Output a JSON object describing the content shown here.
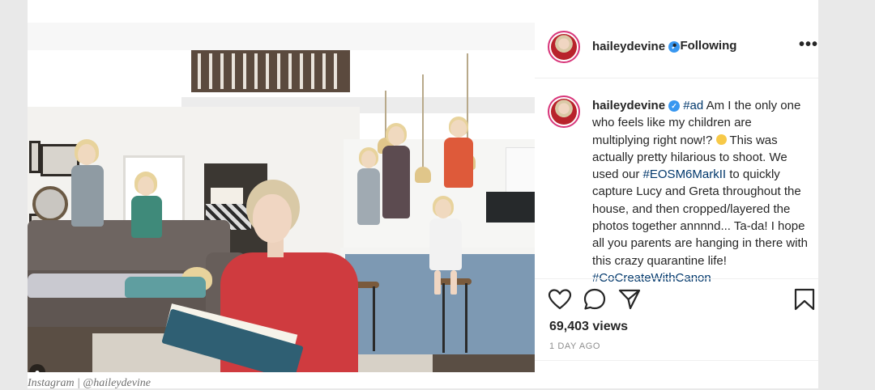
{
  "post": {
    "username": "haileydevine",
    "follow_status": "Following",
    "caption_parts": {
      "hashtag_ad": "#ad",
      "text1": " Am I the only one who feels like my children are multiplying right now!?",
      "text2": " This was actually pretty hilarious to shoot. We used our ",
      "hashtag_camera": "#EOSM6MarkII",
      "text3": " to quickly capture Lucy and Greta throughout the house, and then cropped/layered the photos together annnnd... Ta-da! I hope all you parents are hanging in there with this crazy quarantine life! ",
      "hashtag_brand": "#CoCreateWithCanon"
    },
    "views": "69,403 views",
    "timestamp": "1 DAY AGO",
    "more_label": "•••",
    "dot_separator": "•",
    "verified_mark": "✓"
  },
  "image_caption": "Instagram | @haileydevine",
  "icons": {
    "like": "heart-icon",
    "comment": "comment-icon",
    "share": "share-icon",
    "save": "bookmark-icon",
    "user_tag": "user-tag-icon",
    "more": "more-options-icon"
  },
  "colors": {
    "verified": "#3897f0",
    "hashtag": "#00376b",
    "avatar_ring": "#d8367a",
    "sweater": "#cf3b3f"
  }
}
